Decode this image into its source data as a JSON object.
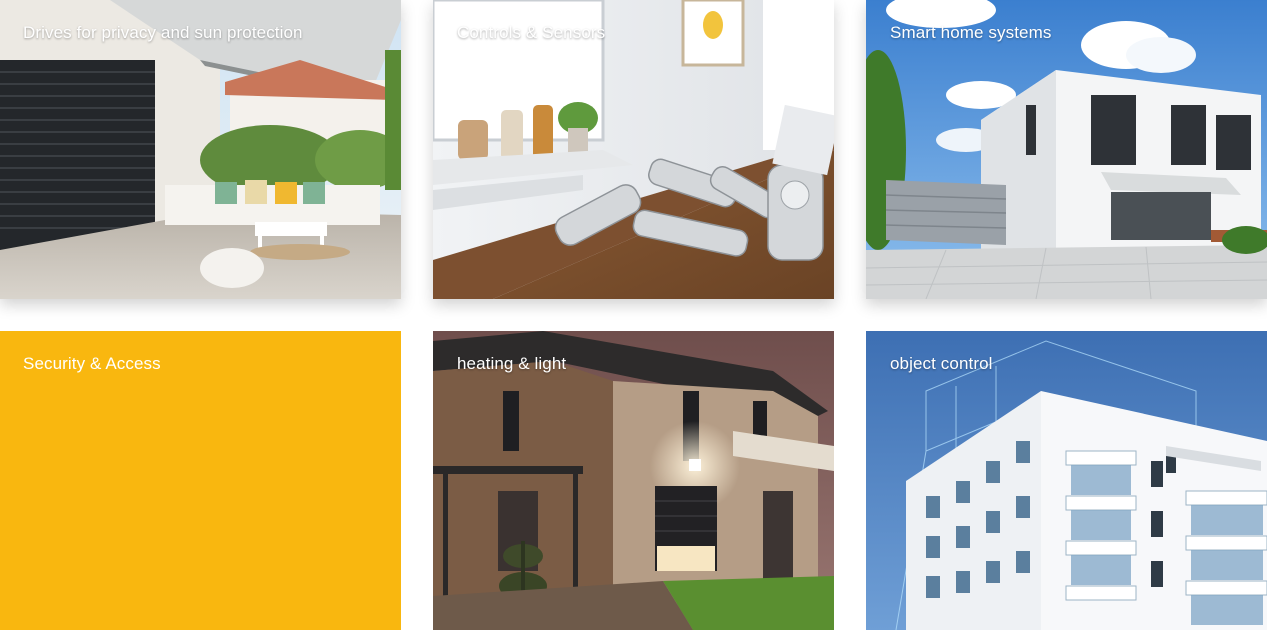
{
  "tiles": [
    {
      "label": "Drives for privacy and sun protection",
      "image": "terrace-awning-photo"
    },
    {
      "label": "Controls & Sensors",
      "image": "remote-controls-photo"
    },
    {
      "label": "Smart home systems",
      "image": "modern-house-photo"
    },
    {
      "label": "Security & Access",
      "image": "",
      "color": "#f9b70f"
    },
    {
      "label": "heating & light",
      "image": "house-night-photo"
    },
    {
      "label": "object control",
      "image": "apartment-building-photo"
    }
  ]
}
